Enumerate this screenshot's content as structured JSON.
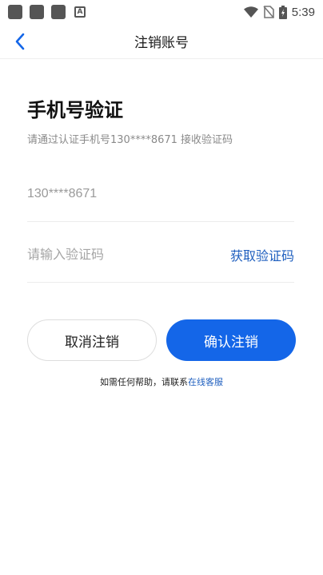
{
  "status_bar": {
    "time": "5:39",
    "notification_badge": "A"
  },
  "header": {
    "title": "注销账号"
  },
  "main": {
    "heading": "手机号验证",
    "subheading": "请通过认证手机号130****8671 接收验证码",
    "phone_value": "130****8671",
    "code_placeholder": "请输入验证码",
    "get_code_label": "获取验证码",
    "cancel_label": "取消注销",
    "confirm_label": "确认注销"
  },
  "help": {
    "text": "如需任何帮助，请联系",
    "link_label": "在线客服"
  },
  "colors": {
    "accent": "#1466e8",
    "link": "#1f5fbf"
  }
}
